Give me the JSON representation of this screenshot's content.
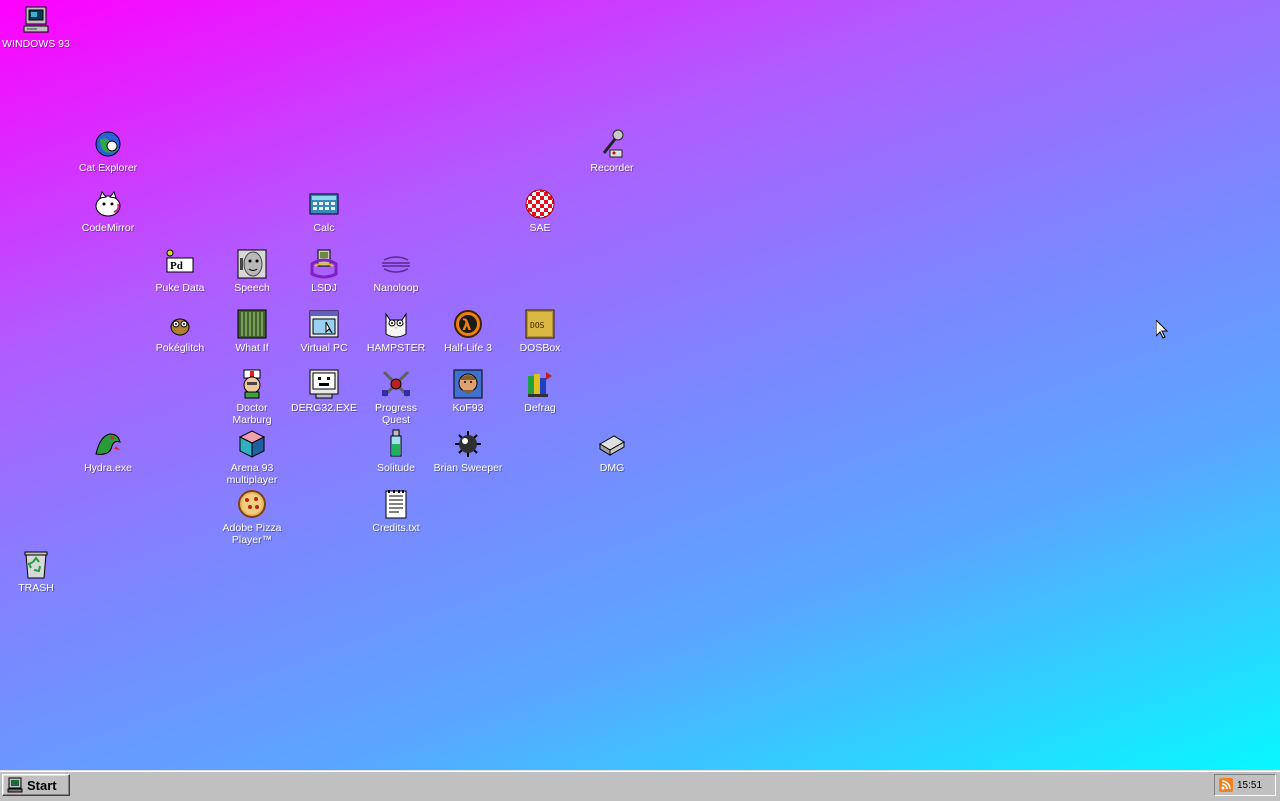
{
  "desktop": {
    "icons": [
      {
        "id": "windows93",
        "label": "WINDOWS 93",
        "icon": "computer-icon"
      },
      {
        "id": "cat-explorer",
        "label": "Cat Explorer",
        "icon": "globe-cat-icon"
      },
      {
        "id": "recorder",
        "label": "Recorder",
        "icon": "microphone-icon"
      },
      {
        "id": "codemirror",
        "label": "CodeMirror",
        "icon": "cat-icon"
      },
      {
        "id": "calc",
        "label": "Calc",
        "icon": "calculator-icon"
      },
      {
        "id": "sae",
        "label": "SAE",
        "icon": "checkered-ball-icon"
      },
      {
        "id": "puke-data",
        "label": "Puke Data",
        "icon": "pd-icon"
      },
      {
        "id": "speech",
        "label": "Speech",
        "icon": "face-icon"
      },
      {
        "id": "lsdj",
        "label": "LSDJ",
        "icon": "gameboy-icon"
      },
      {
        "id": "nanoloop",
        "label": "Nanoloop",
        "icon": "waves-icon"
      },
      {
        "id": "pokeglitch",
        "label": "Pokéglitch",
        "icon": "glitch-creature-icon"
      },
      {
        "id": "what-if",
        "label": "What If",
        "icon": "grid-panel-icon"
      },
      {
        "id": "virtual-pc",
        "label": "Virtual PC",
        "icon": "window-icon"
      },
      {
        "id": "hampster",
        "label": "HAMPSTER",
        "icon": "owl-icon"
      },
      {
        "id": "half-life-3",
        "label": "Half-Life 3",
        "icon": "lambda-icon"
      },
      {
        "id": "dosbox",
        "label": "DOSBox",
        "icon": "dosbox-icon"
      },
      {
        "id": "doctor-marburg",
        "label": "Doctor Marburg",
        "icon": "doctor-icon"
      },
      {
        "id": "derg32",
        "label": "DERG32.EXE",
        "icon": "monitor-face-icon"
      },
      {
        "id": "progress-quest",
        "label": "Progress Quest",
        "icon": "crossed-swords-icon"
      },
      {
        "id": "kof93",
        "label": "KoF93",
        "icon": "fighter-portrait-icon"
      },
      {
        "id": "defrag",
        "label": "Defrag",
        "icon": "defrag-icon"
      },
      {
        "id": "hydra",
        "label": "Hydra.exe",
        "icon": "dragon-icon"
      },
      {
        "id": "arena93",
        "label": "Arena 93 multiplayer",
        "icon": "cube-icon"
      },
      {
        "id": "solitude",
        "label": "Solitude",
        "icon": "bottle-icon"
      },
      {
        "id": "brian-sweeper",
        "label": "Brian Sweeper",
        "icon": "mine-icon"
      },
      {
        "id": "dmg",
        "label": "DMG",
        "icon": "disk-drive-icon"
      },
      {
        "id": "adobe-pizza",
        "label": "Adobe Pizza Player™",
        "icon": "pizza-icon"
      },
      {
        "id": "credits",
        "label": "Credits.txt",
        "icon": "text-file-icon"
      },
      {
        "id": "trash",
        "label": "TRASH",
        "icon": "recycle-bin-icon"
      }
    ]
  },
  "taskbar": {
    "start_label": "Start",
    "clock": "15:51",
    "tray_icon": "rss-icon"
  },
  "colors": {
    "taskbar": "#c0c0c0",
    "gradient_start": "#ff00ff",
    "gradient_end": "#00ffff"
  }
}
